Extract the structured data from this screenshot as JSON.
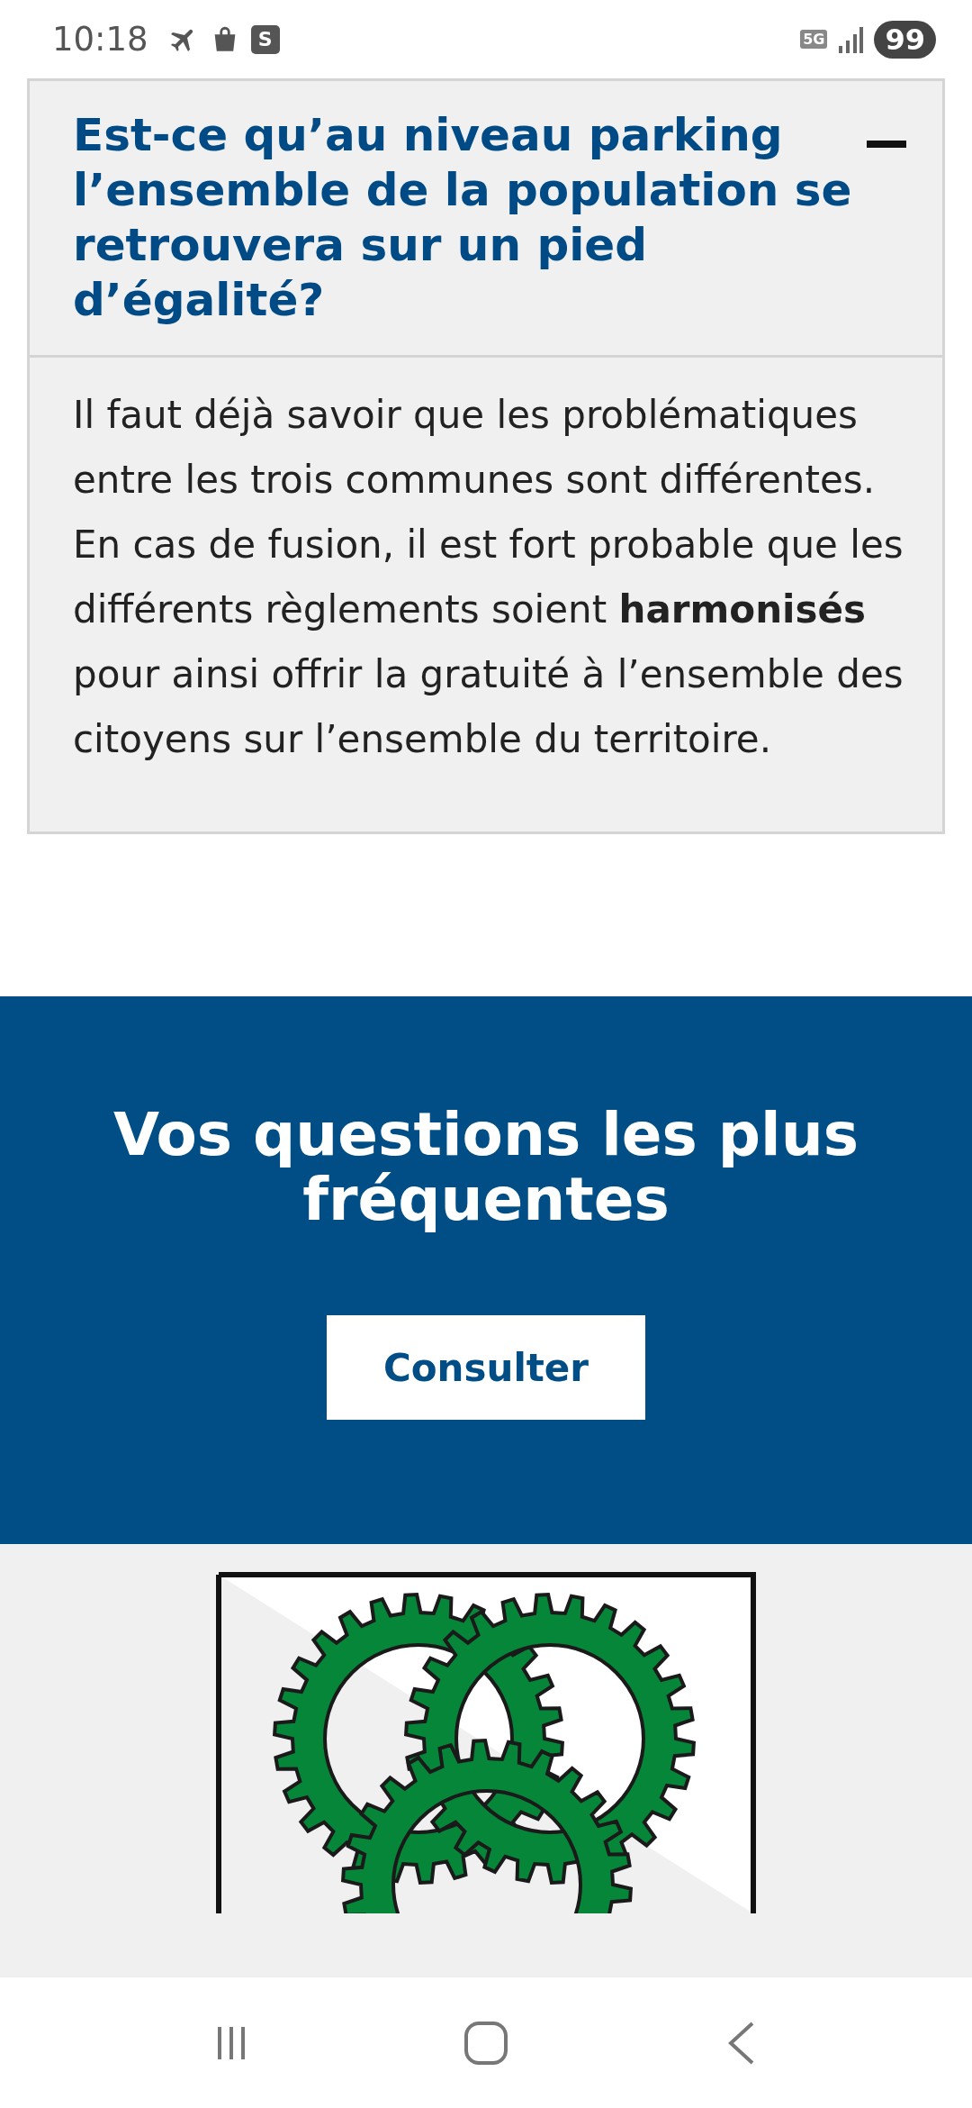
{
  "status_bar": {
    "time": "10:18",
    "notification_badge": "S",
    "network": "5G",
    "battery": "99"
  },
  "faq_item": {
    "question": "Est-ce qu’au niveau parking l’ensemble de la population se retrouvera sur un pied d’égalité?",
    "expanded": true,
    "answer": "Il faut déjà savoir que les problématiques entre les trois communes sont différentes. En cas de fusion, il est fort probable que les différents règlements soient **harmonisés** pour ainsi offrir la gratuité à l’ensemble des citoyens sur l’ensemble du territoire."
  },
  "faq_banner": {
    "title": "Vos questions les plus fréquentes",
    "button": "Consulter"
  }
}
